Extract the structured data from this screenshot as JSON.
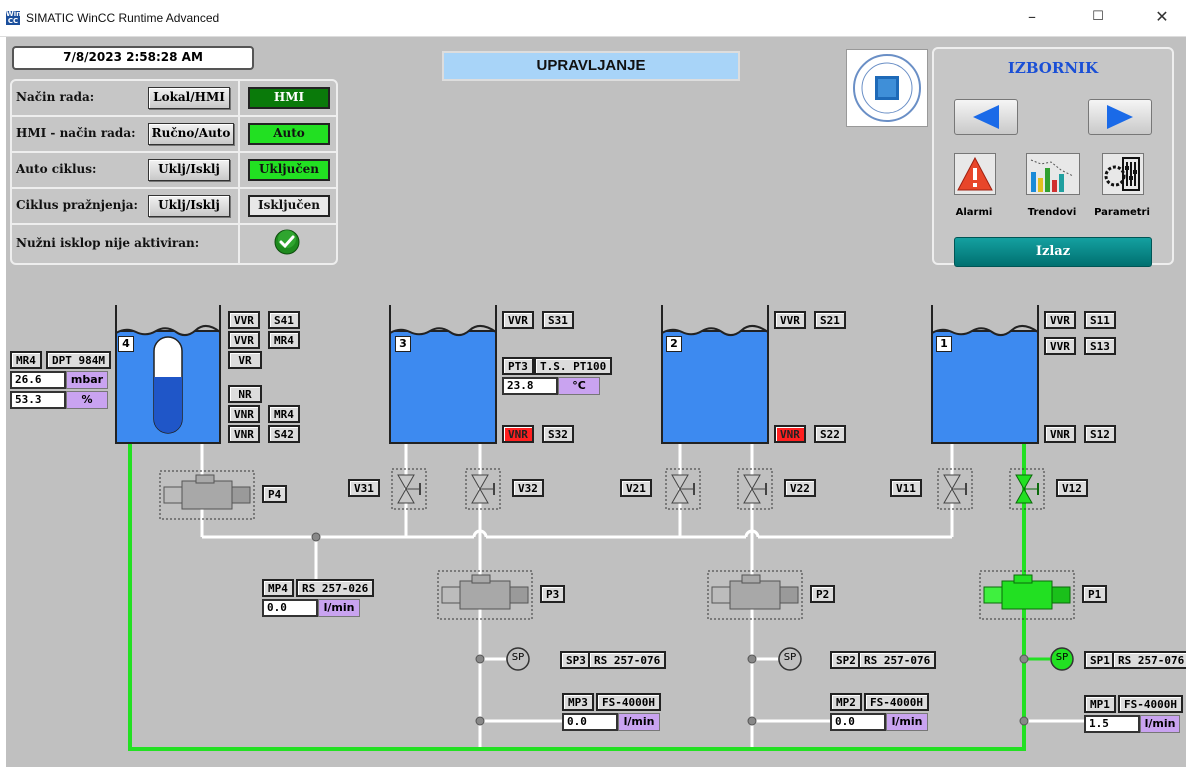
{
  "window": {
    "title": "SIMATIC WinCC Runtime Advanced",
    "icon_text": "WinCC RT"
  },
  "datetime": "7/8/2023 2:58:28 AM",
  "screen_title": "UPRAVLJANJE",
  "control_panel": {
    "rows": [
      {
        "label": "Način rada:",
        "button": "Lokal/HMI",
        "status": "HMI",
        "status_color": "#0a7a0a"
      },
      {
        "label": "HMI - način rada:",
        "button": "Ručno/Auto",
        "status": "Auto",
        "status_color": "#22e022"
      },
      {
        "label": "Auto ciklus:",
        "button": "Uklj/Isklj",
        "status": "Uključen",
        "status_color": "#22e022"
      },
      {
        "label": "Ciklus pražnjenja:",
        "button": "Uklj/Isklj",
        "status": "Isključen",
        "status_color": "#e8e8e8"
      },
      {
        "label": "Nužni isklop nije aktiviran:",
        "icon": "check-icon"
      }
    ]
  },
  "menu": {
    "title": "IZBORNIK",
    "items": [
      {
        "label": "Alarmi",
        "icon": "alarm-warning-icon"
      },
      {
        "label": "Trendovi",
        "icon": "trend-chart-icon"
      },
      {
        "label": "Parametri",
        "icon": "parameters-sliders-icon"
      }
    ],
    "exit_label": "Izlaz"
  },
  "tanks": [
    {
      "number": "4",
      "level_percent": 53.3
    },
    {
      "number": "3"
    },
    {
      "number": "2"
    },
    {
      "number": "1"
    }
  ],
  "tank4_tags": {
    "vvr": "VVR",
    "s41": "S41",
    "vvr2": "VVR",
    "mr4": "MR4",
    "vr": "VR",
    "nr": "NR",
    "vnr": "VNR",
    "mr4b": "MR4",
    "vnr2": "VNR",
    "s42": "S42"
  },
  "tank4_sensor": {
    "name": "MR4",
    "model": "DPT 984M",
    "pressure": "26.6",
    "pressure_unit": "mbar",
    "level": "53.3",
    "level_unit": "%"
  },
  "tank3_tags": {
    "vvr": "VVR",
    "s31": "S31",
    "vnr": "VNR",
    "s32": "S32"
  },
  "tank3_sensor": {
    "name": "PT3",
    "model": "T.S. PT100",
    "temp": "23.8",
    "temp_unit": "°C"
  },
  "tank2_tags": {
    "vvr": "VVR",
    "s21": "S21",
    "vnr": "VNR",
    "s22": "S22"
  },
  "tank1_tags": {
    "vvr": "VVR",
    "s11": "S11",
    "vvr2": "VVR",
    "s13": "S13",
    "vnr": "VNR",
    "s12": "S12"
  },
  "pumps": [
    {
      "name": "P4",
      "active": false
    },
    {
      "name": "P3",
      "active": false
    },
    {
      "name": "P2",
      "active": false
    },
    {
      "name": "P1",
      "active": true
    }
  ],
  "valves": [
    "V31",
    "V32",
    "V21",
    "V22",
    "V11",
    "V12"
  ],
  "active_color": "#22e022",
  "alarm_color": "#ff2020",
  "flow_meters": {
    "mp4": {
      "name": "MP4",
      "model": "RS 257-026",
      "value": "0.0",
      "unit": "l/min"
    },
    "mp3": {
      "name": "MP3",
      "model": "FS-4000H",
      "value": "0.0",
      "unit": "l/min"
    },
    "mp2": {
      "name": "MP2",
      "model": "FS-4000H",
      "value": "0.0",
      "unit": "l/min"
    },
    "mp1": {
      "name": "MP1",
      "model": "FS-4000H",
      "value": "1.5",
      "unit": "l/min"
    }
  },
  "pressure_switches": {
    "sp3": {
      "symbol": "SP",
      "name": "SP3",
      "model": "RS 257-076"
    },
    "sp2": {
      "symbol": "SP",
      "name": "SP2",
      "model": "RS 257-076"
    },
    "sp1": {
      "symbol": "SP",
      "name": "SP1",
      "model": "RS 257-076"
    }
  }
}
